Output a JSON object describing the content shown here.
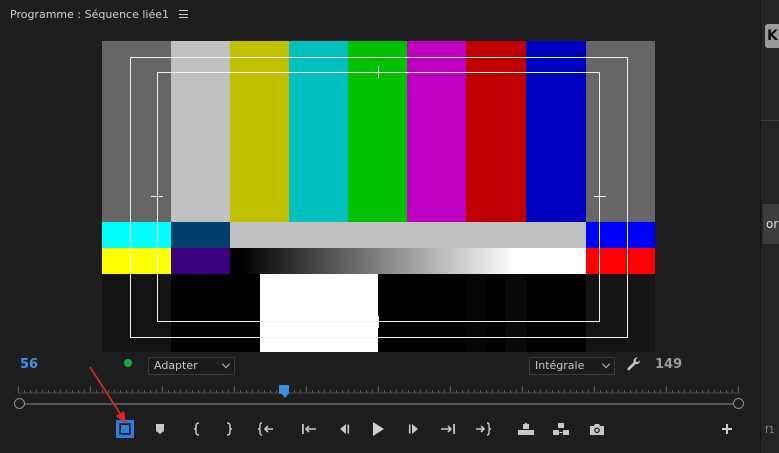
{
  "panel": {
    "title": "Programme : Séquence liée1"
  },
  "monitor": {
    "timecode_in": "56",
    "timecode_out": "149",
    "fit_select": {
      "selected": "Adapter"
    },
    "quality_select": {
      "selected": "Intégrale"
    }
  },
  "side_edge": {
    "tab_top": "K",
    "tab_mid": "or",
    "bottom_text": "f1"
  },
  "colors": {
    "accent_blue": "#3b95e8",
    "dot_green": "#1fa83a",
    "annotation_red": "#e02828"
  },
  "toolbar": {
    "buttons": [
      {
        "icon": "safe-margins-icon",
        "active": true
      },
      {
        "icon": "marker-icon"
      },
      {
        "icon": "mark-in-icon"
      },
      {
        "icon": "mark-out-icon"
      },
      {
        "icon": "go-to-in-icon"
      },
      {
        "icon": "step-back-edit-icon"
      },
      {
        "icon": "step-back-frame-icon"
      },
      {
        "icon": "play-icon"
      },
      {
        "icon": "step-forward-frame-icon"
      },
      {
        "icon": "step-forward-edit-icon"
      },
      {
        "icon": "go-to-out-icon"
      },
      {
        "icon": "lift-icon"
      },
      {
        "icon": "extract-icon"
      },
      {
        "icon": "export-frame-icon"
      },
      {
        "icon": "add-button-icon"
      }
    ]
  }
}
